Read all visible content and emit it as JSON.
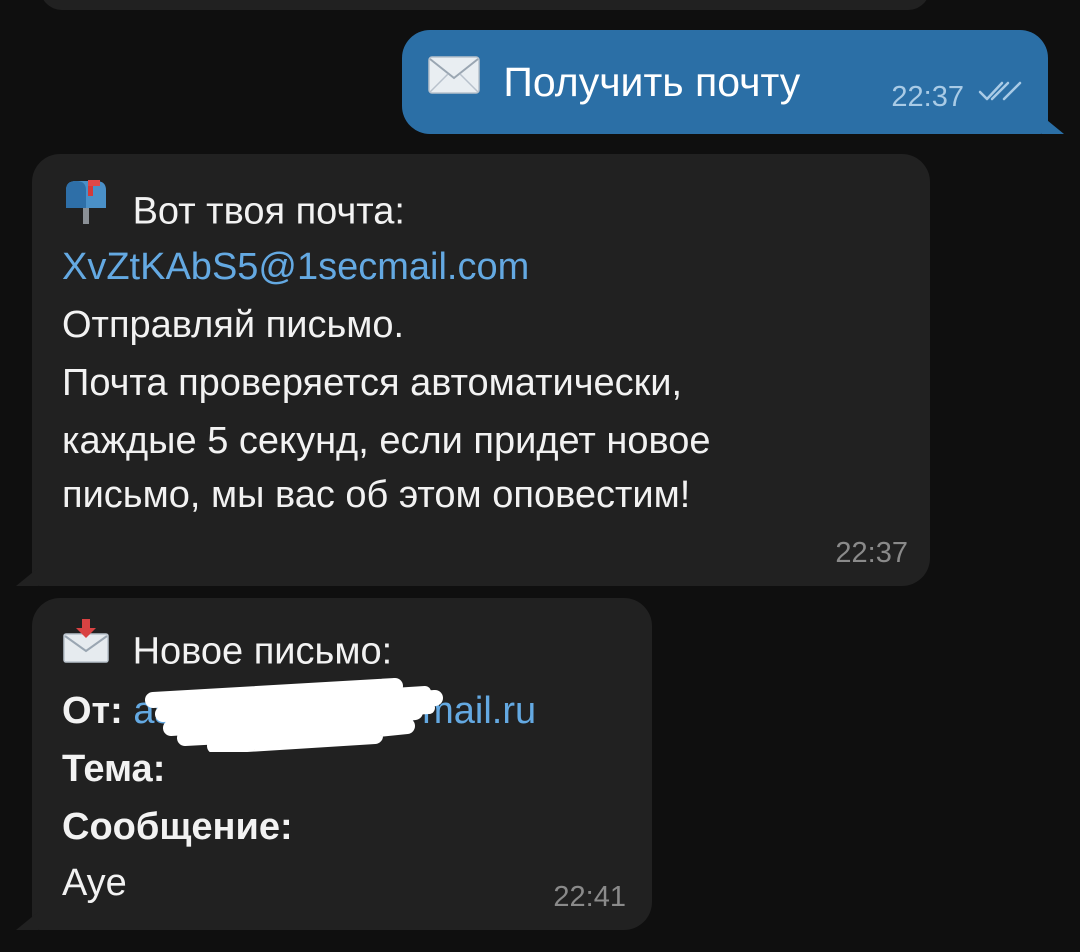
{
  "outgoing_message": {
    "icon": "envelope-icon",
    "text": "Получить почту",
    "time": "22:37",
    "status": "read"
  },
  "mailbox_message": {
    "icon": "mailbox-icon",
    "title": "Вот твоя почта:",
    "email": "XvZtKAbS5@1secmail.com",
    "line_send": "Отправляй письмо.",
    "line_auto_1": "Почта проверяется автоматически,",
    "line_auto_2": "каждые 5 секунд, если придет новое",
    "line_auto_3": "письмо, мы вас об этом оповестим!",
    "time": "22:37"
  },
  "new_mail_message": {
    "icon": "incoming-envelope-icon",
    "title": "Новое письмо:",
    "from_label": "От:",
    "from_prefix": "as",
    "from_suffix": "@mail.ru",
    "subject_label": "Тема:",
    "body_label": "Сообщение:",
    "body_text": "Aye",
    "time": "22:41"
  },
  "colors": {
    "background": "#0f0f0f",
    "incoming_bubble": "#212121",
    "outgoing_bubble": "#2b6fa6",
    "link": "#64a9e2",
    "text": "#f2f2f2",
    "time": "#8a8a8a"
  }
}
